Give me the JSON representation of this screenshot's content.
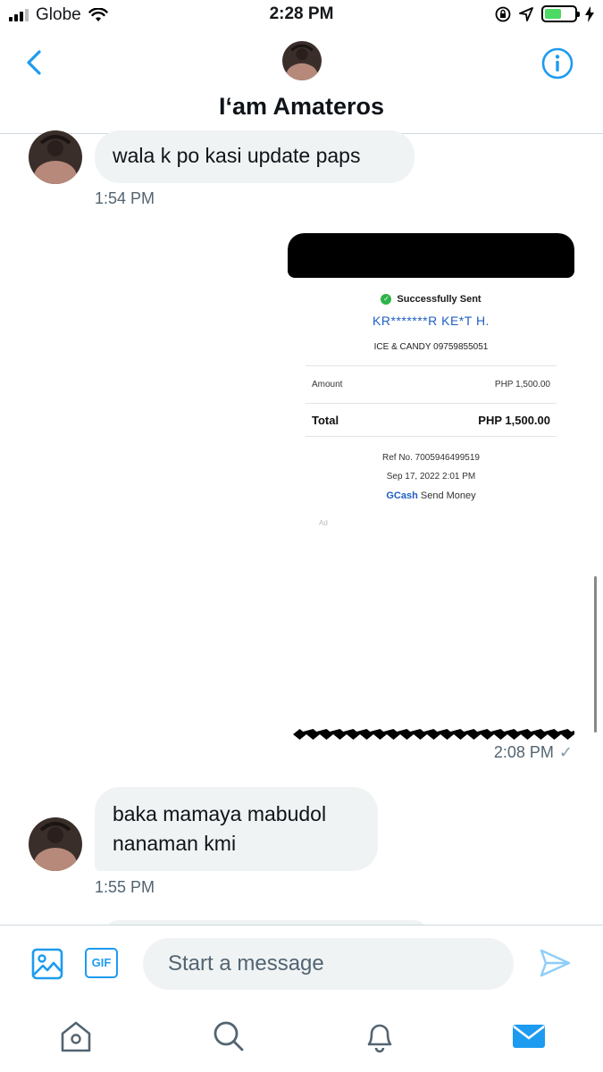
{
  "status": {
    "carrier": "Globe",
    "time": "2:28 PM",
    "battery_color": "#4cd964"
  },
  "header": {
    "title": "I‘am Amateros",
    "back_icon": "chevron-left-icon",
    "info_icon": "info-icon"
  },
  "messages": [
    {
      "from": "them",
      "text": "wala k po kasi update paps",
      "time": "1:54 PM"
    },
    {
      "from": "me",
      "type": "image",
      "time": "2:08 PM",
      "status": "✓",
      "receipt": {
        "status": "Successfully Sent",
        "recipient": "KR*******R KE*T H.",
        "merchant": "ICE & CANDY 09759855051",
        "amount_label": "Amount",
        "amount": "PHP 1,500.00",
        "total_label": "Total",
        "total": "PHP 1,500.00",
        "ref": "Ref No. 7005946499519",
        "date": "Sep 17, 2022 2:01 PM",
        "brand": "GCash",
        "service": "Send Money",
        "ad": "Ad"
      }
    },
    {
      "from": "them",
      "text_line1": "baka mamaya mabudol",
      "text_line2": "nanaman kmi",
      "time": "1:55 PM"
    }
  ],
  "compose": {
    "placeholder": "Start a message",
    "media_icon": "image-icon",
    "gif_label": "GIF",
    "send_icon": "send-icon"
  },
  "tabs": [
    "home-icon",
    "search-icon",
    "bell-icon",
    "mail-icon"
  ],
  "colors": {
    "accent": "#1d9bf0",
    "bubble_bg": "#eff3f4",
    "muted_text": "#536471"
  }
}
